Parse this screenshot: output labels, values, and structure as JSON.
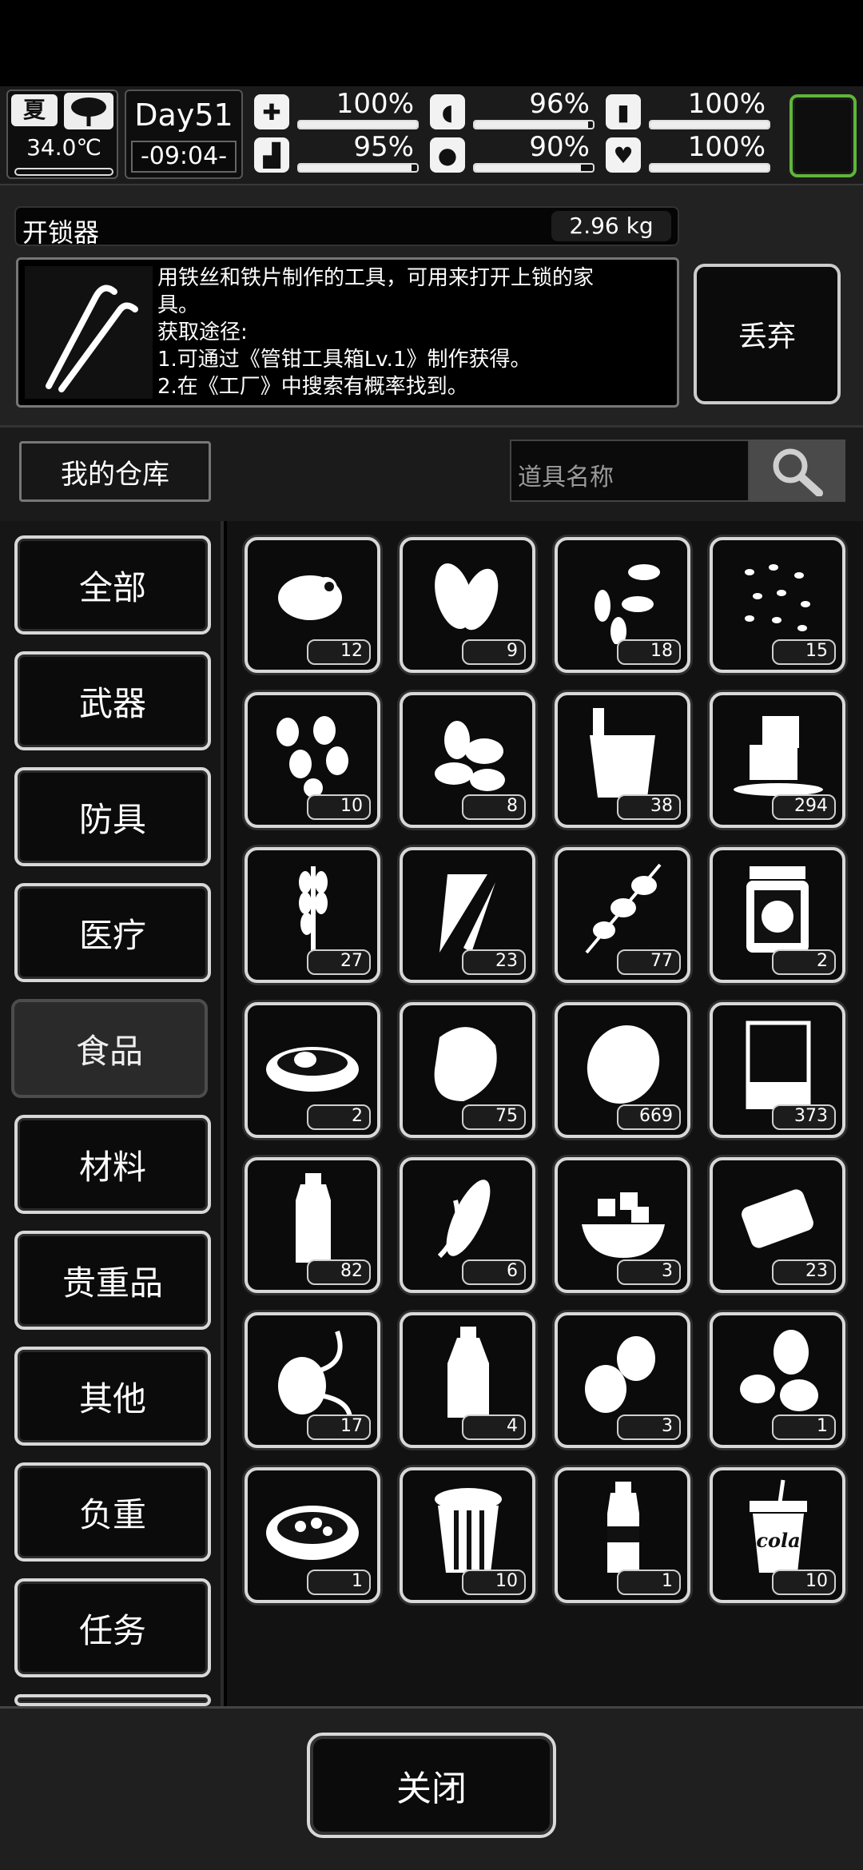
{
  "status": {
    "season": "夏",
    "temperature": "34.0℃",
    "day": "Day51",
    "time": "-09:04-",
    "stats": [
      {
        "icon": "medkit-icon",
        "value": "100%",
        "level": 1.0
      },
      {
        "icon": "stomach-icon",
        "value": "96%",
        "level": 0.96
      },
      {
        "icon": "pill-icon",
        "value": "100%",
        "level": 1.0
      },
      {
        "icon": "foot-icon",
        "value": "95%",
        "level": 0.95
      },
      {
        "icon": "water-drop-icon",
        "value": "90%",
        "level": 0.9
      },
      {
        "icon": "heart-icon",
        "value": "100%",
        "level": 1.0
      }
    ]
  },
  "item": {
    "name": "开锁器",
    "weight": "2.96 kg",
    "description_lines": [
      "用铁丝和铁片制作的工具，可用来打开上锁的家",
      "具。",
      "获取途径:",
      "1.可通过《管钳工具箱Lv.1》制作获得。",
      "2.在《工厂》中搜索有概率找到。"
    ],
    "discard_label": "丢弃"
  },
  "storage": {
    "title": "我的仓库",
    "search_placeholder": "道具名称"
  },
  "categories": [
    "全部",
    "武器",
    "防具",
    "医疗",
    "食品",
    "材料",
    "贵重品",
    "其他",
    "负重",
    "任务"
  ],
  "selected_category": "食品",
  "items": [
    {
      "name": "chicken-icon",
      "count": "12"
    },
    {
      "name": "seed-pods-icon",
      "count": "9"
    },
    {
      "name": "sunflower-seeds-icon",
      "count": "18"
    },
    {
      "name": "rice-grains-icon",
      "count": "15"
    },
    {
      "name": "peanuts-icon",
      "count": "10"
    },
    {
      "name": "almonds-icon",
      "count": "8"
    },
    {
      "name": "ice-bucket-icon",
      "count": "38"
    },
    {
      "name": "ice-cubes-icon",
      "count": "294"
    },
    {
      "name": "wheat-icon",
      "count": "27"
    },
    {
      "name": "carrot-icon",
      "count": "23"
    },
    {
      "name": "skewer-icon",
      "count": "77"
    },
    {
      "name": "pickle-jar-icon",
      "count": "2"
    },
    {
      "name": "soup-bowl-icon",
      "count": "2"
    },
    {
      "name": "meat-steak-icon",
      "count": "75"
    },
    {
      "name": "potato-icon",
      "count": "669"
    },
    {
      "name": "beaker-icon",
      "count": "373"
    },
    {
      "name": "water-bottle-icon",
      "count": "82"
    },
    {
      "name": "corn-icon",
      "count": "6"
    },
    {
      "name": "tofu-bowl-icon",
      "count": "3"
    },
    {
      "name": "bread-icon",
      "count": "23"
    },
    {
      "name": "sprouted-potato-icon",
      "count": "17"
    },
    {
      "name": "sauce-bottle-icon",
      "count": "4"
    },
    {
      "name": "eggs-icon",
      "count": "3"
    },
    {
      "name": "coffee-beans-icon",
      "count": "1"
    },
    {
      "name": "stew-bowl-icon",
      "count": "1"
    },
    {
      "name": "popcorn-icon",
      "count": "10"
    },
    {
      "name": "soda-bottle-icon",
      "count": "1"
    },
    {
      "name": "cola-cup-icon",
      "count": "10"
    }
  ],
  "cola_text": "cola",
  "close_label": "关闭"
}
